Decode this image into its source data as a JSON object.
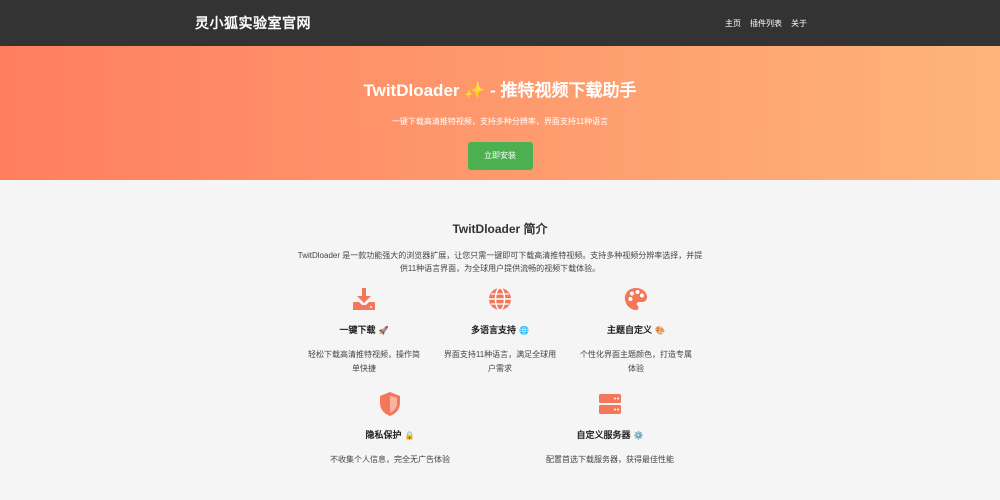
{
  "nav": {
    "brand": "灵小狐实验室官网",
    "links": [
      "主页",
      "插件列表",
      "关于"
    ]
  },
  "hero": {
    "title": "TwitDloader ✨ - 推特视频下载助手",
    "subtitle": "一键下载高清推特视频，支持多种分辨率，界面支持11种语言",
    "button": "立即安装"
  },
  "intro": {
    "title": "TwitDloader 简介",
    "text": "TwitDloader 是一款功能强大的浏览器扩展，让您只需一键即可下载高清推特视频。支持多种视频分辨率选择，并提供11种语言界面，为全球用户提供流畅的视频下载体验。"
  },
  "features": [
    {
      "icon": "download-icon",
      "title": "一键下载",
      "emoji": "🚀",
      "desc": "轻松下载高清推特视频，操作简单快捷"
    },
    {
      "icon": "globe-icon",
      "title": "多语言支持",
      "emoji": "🌐",
      "desc": "界面支持11种语言，满足全球用户需求"
    },
    {
      "icon": "palette-icon",
      "title": "主题自定义",
      "emoji": "🎨",
      "desc": "个性化界面主题颜色，打造专属体验"
    },
    {
      "icon": "shield-icon",
      "title": "隐私保护",
      "emoji": "🔒",
      "desc": "不收集个人信息，完全无广告体验"
    },
    {
      "icon": "server-icon",
      "title": "自定义服务器",
      "emoji": "⚙️",
      "desc": "配置首选下载服务器，获得最佳性能"
    }
  ],
  "colors": {
    "accent": "#f4775a",
    "nav_bg": "#333333",
    "hero_start": "#ff7e5f",
    "hero_end": "#feb47b",
    "button": "#4caf50"
  }
}
